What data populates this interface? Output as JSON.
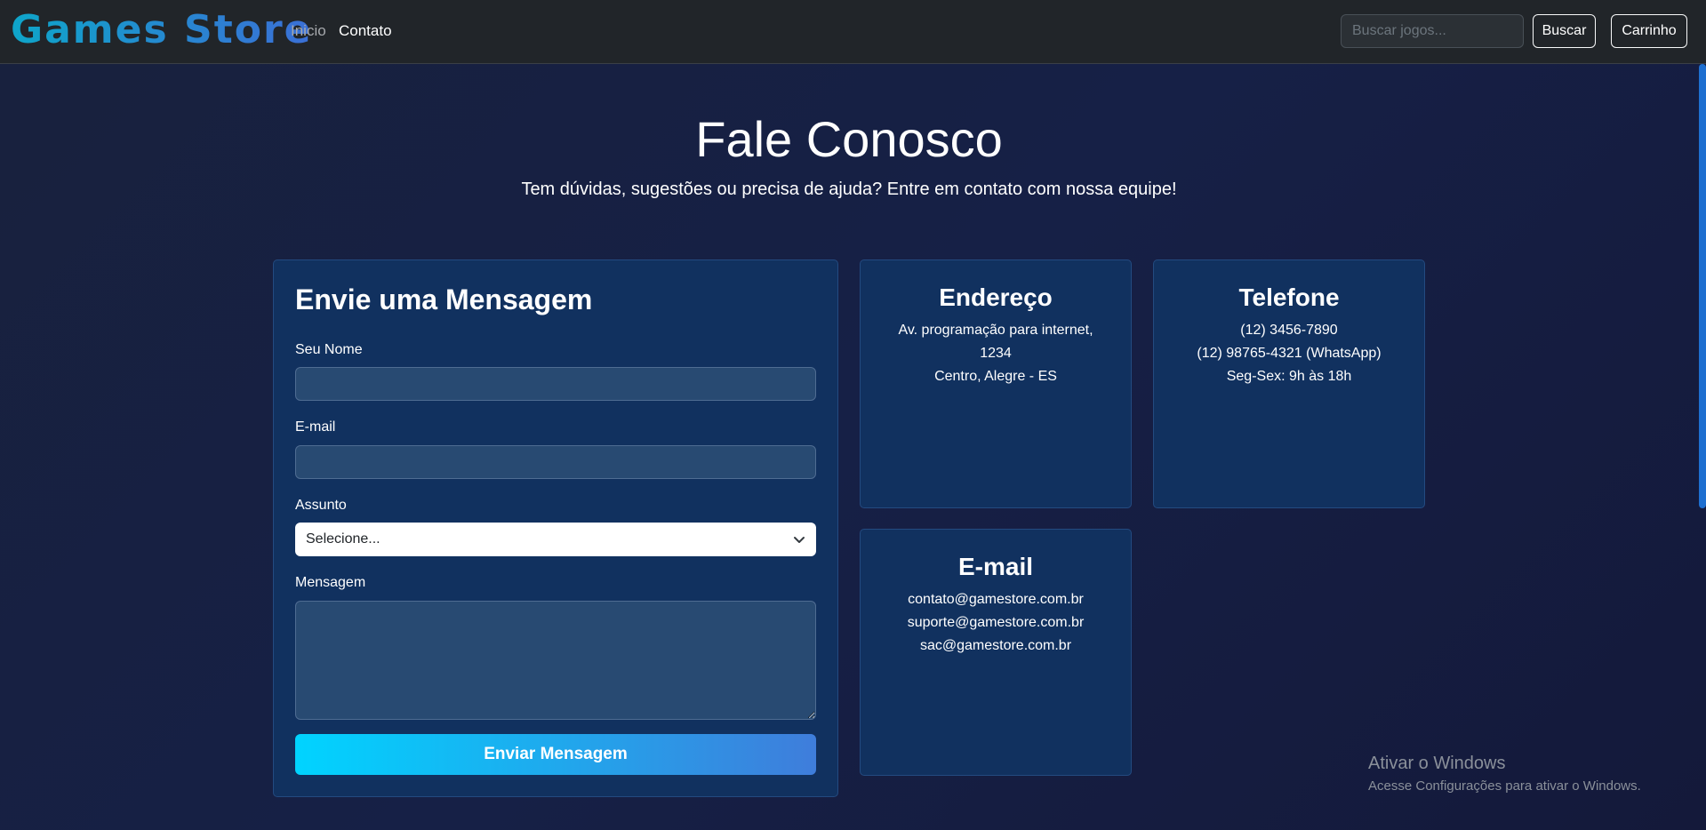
{
  "navbar": {
    "brand": "Games Store",
    "links": [
      "Inicio",
      "Contato"
    ],
    "search_placeholder": "Buscar jogos...",
    "search_button": "Buscar",
    "cart_button": "Carrinho"
  },
  "hero": {
    "title": "Fale Conosco",
    "subtitle": "Tem dúvidas, sugestões ou precisa de ajuda? Entre em contato com nossa equipe!"
  },
  "form": {
    "title": "Envie uma Mensagem",
    "name_label": "Seu Nome",
    "email_label": "E-mail",
    "subject_label": "Assunto",
    "subject_selected": "Selecione...",
    "message_label": "Mensagem",
    "submit_label": "Enviar Mensagem"
  },
  "address": {
    "title": "Endereço",
    "line1": "Av. programação para internet,",
    "line2": "1234",
    "line3": "Centro, Alegre - ES"
  },
  "phone": {
    "title": "Telefone",
    "line1": "(12) 3456-7890",
    "line2": "(12) 98765-4321 (WhatsApp)",
    "line3": "Seg-Sex: 9h às 18h"
  },
  "email": {
    "title": "E-mail",
    "line1": "contato@gamestore.com.br",
    "line2": "suporte@gamestore.com.br",
    "line3": "sac@gamestore.com.br"
  },
  "watermark": {
    "title": "Ativar o Windows",
    "subtitle": "Acesse Configurações para ativar o Windows."
  },
  "colors": {
    "navbar_bg": "#212529",
    "card_bg": "#11315f",
    "accent_start": "#00d4ff",
    "accent_end": "#3f7ddb"
  }
}
